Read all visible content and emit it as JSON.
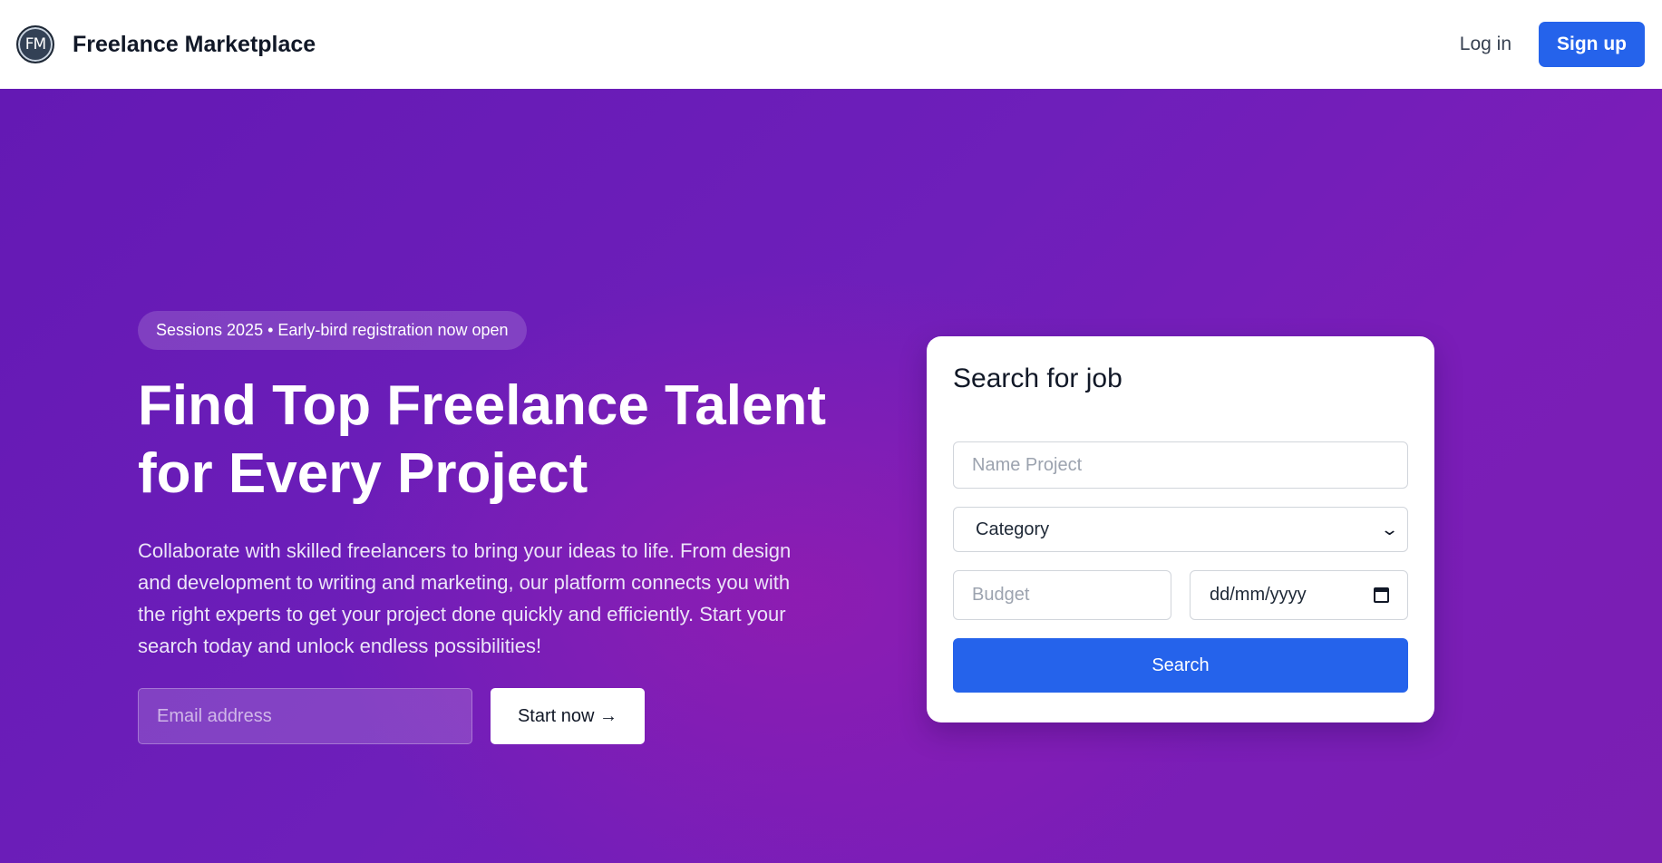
{
  "header": {
    "logo_text": "FM",
    "brand": "Freelance Marketplace",
    "login_label": "Log in",
    "signup_label": "Sign up"
  },
  "hero": {
    "badge": "Sessions 2025 • Early-bird registration now open",
    "headline": "Find Top Freelance Talent for Every Project",
    "description": "Collaborate with skilled freelancers to bring your ideas to life. From design and development to writing and marketing, our platform connects you with the right experts to get your project done quickly and efficiently. Start your search today and unlock endless possibilities!",
    "email_placeholder": "Email address",
    "cta_label": "Start now →"
  },
  "search_card": {
    "title": "Search for job",
    "name_placeholder": "Name Project",
    "category_selected": "Category",
    "budget_placeholder": "Budget",
    "date_placeholder": "dd/mm/yyyy",
    "search_label": "Search"
  },
  "icons": {
    "logo": "fm-monogram-logo",
    "select_arrow": "chevron-down-icon",
    "date_picker": "calendar-icon"
  },
  "colors": {
    "primary": "#2563eb",
    "hero_gradient_start": "#6419b4",
    "hero_gradient_accent": "#961caf",
    "text_dark": "#111827"
  }
}
